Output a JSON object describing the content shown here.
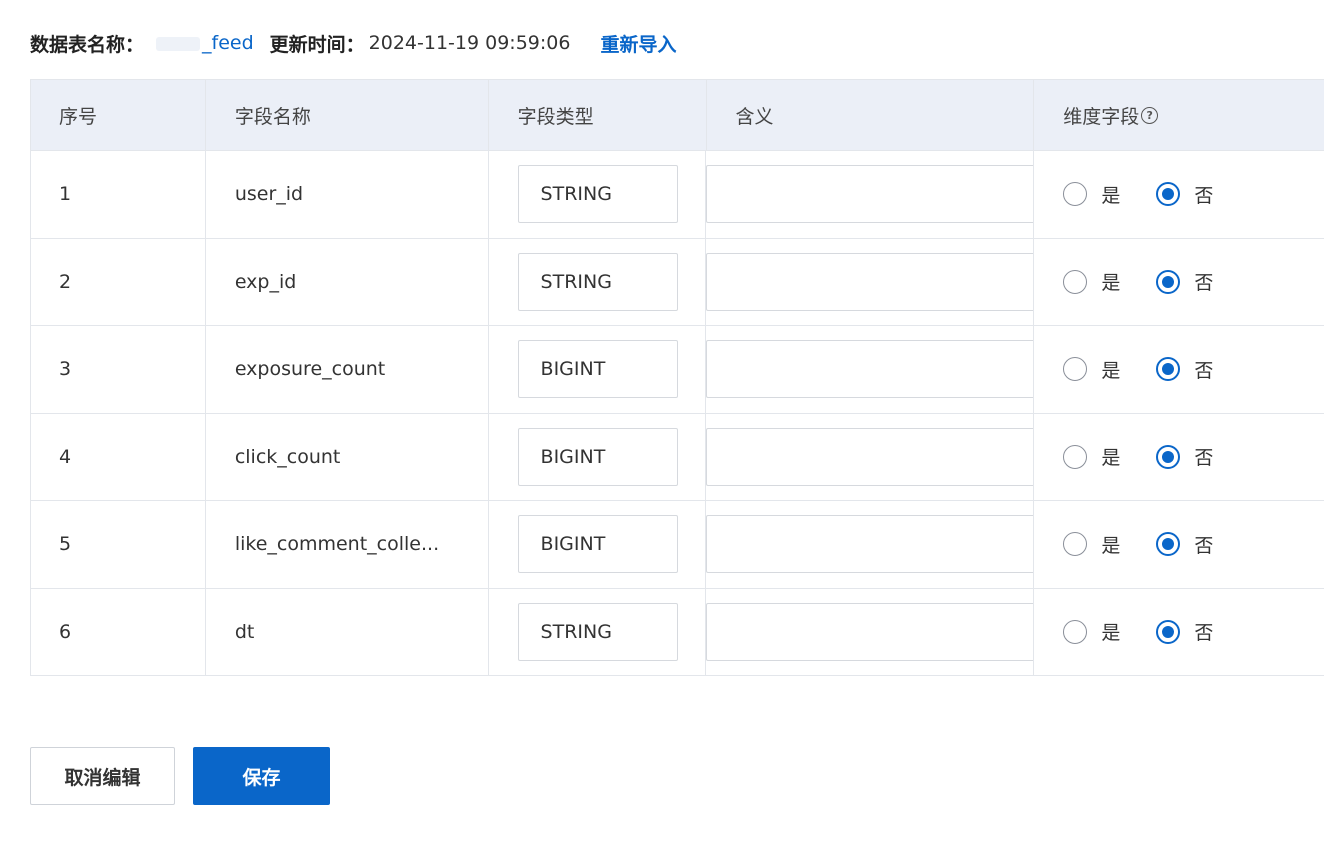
{
  "header": {
    "table_name_label": "数据表名称：",
    "table_name_value": "_feed",
    "update_time_label": "更新时间：",
    "update_time_value": "2024-11-19 09:59:06",
    "reimport_label": "重新导入"
  },
  "table": {
    "columns": [
      "序号",
      "字段名称",
      "字段类型",
      "含义",
      "维度字段"
    ],
    "help_icon": "question-circle-icon",
    "radio_yes_label": "是",
    "radio_no_label": "否",
    "rows": [
      {
        "index": "1",
        "field_name": "user_id",
        "field_type": "STRING",
        "meaning": "",
        "dimension": "否"
      },
      {
        "index": "2",
        "field_name": "exp_id",
        "field_type": "STRING",
        "meaning": "",
        "dimension": "否"
      },
      {
        "index": "3",
        "field_name": "exposure_count",
        "field_type": "BIGINT",
        "meaning": "",
        "dimension": "否"
      },
      {
        "index": "4",
        "field_name": "click_count",
        "field_type": "BIGINT",
        "meaning": "",
        "dimension": "否"
      },
      {
        "index": "5",
        "field_name": "like_comment_colle...",
        "field_type": "BIGINT",
        "meaning": "",
        "dimension": "否"
      },
      {
        "index": "6",
        "field_name": "dt",
        "field_type": "STRING",
        "meaning": "",
        "dimension": "否"
      }
    ]
  },
  "actions": {
    "cancel_label": "取消编辑",
    "save_label": "保存"
  },
  "colors": {
    "accent": "#0a66c9",
    "header_bg": "#ebeff7",
    "border": "#e3e6eb"
  }
}
